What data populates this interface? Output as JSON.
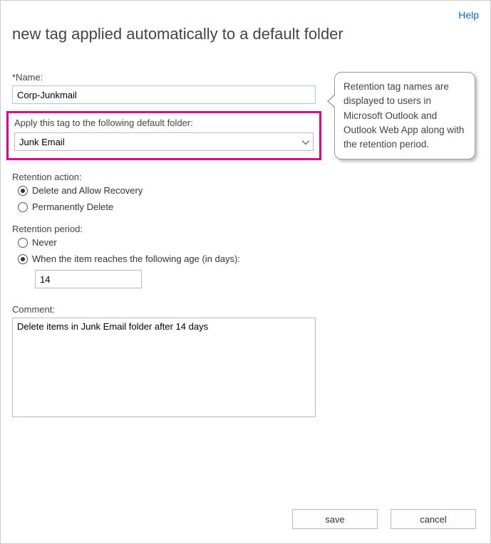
{
  "header": {
    "help_label": "Help",
    "title": "new tag applied automatically to a default folder"
  },
  "fields": {
    "name": {
      "label": "*Name:",
      "value": "Corp-Junkmail"
    },
    "folder": {
      "label": "Apply this tag to the following default folder:",
      "value": "Junk Email"
    },
    "retention_action": {
      "label": "Retention action:",
      "options": [
        {
          "label": "Delete and Allow Recovery",
          "selected": true
        },
        {
          "label": "Permanently Delete",
          "selected": false
        }
      ]
    },
    "retention_period": {
      "label": "Retention period:",
      "options": [
        {
          "label": "Never",
          "selected": false
        },
        {
          "label": "When the item reaches the following age (in days):",
          "selected": true
        }
      ],
      "days_value": "14"
    },
    "comment": {
      "label": "Comment:",
      "value": "Delete items in Junk Email folder after 14 days"
    }
  },
  "callout": {
    "text": "Retention tag names are displayed to users in Microsoft Outlook and Outlook Web App along with the retention period."
  },
  "buttons": {
    "save": "save",
    "cancel": "cancel"
  }
}
